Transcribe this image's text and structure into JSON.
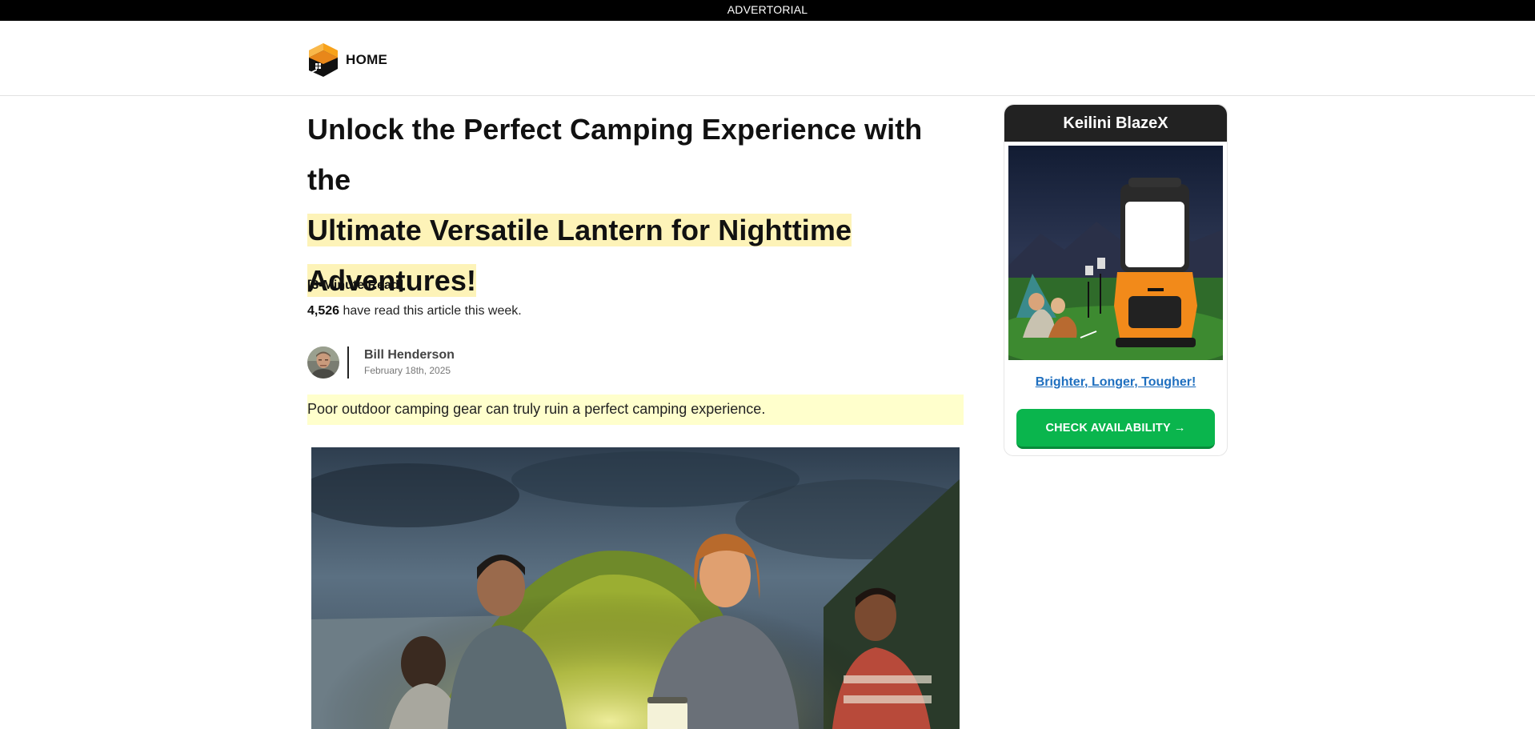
{
  "topbar": {
    "label": "ADVERTORIAL"
  },
  "header": {
    "logo_text": "HOME",
    "logo_icon": "house-cube-icon"
  },
  "article": {
    "headline_plain": "Unlock the Perfect Camping Experience with the",
    "headline_highlight_1": "Ultimate Versatile Lantern for Nighttime",
    "headline_highlight_2": "Adventures!",
    "read_time": "[3-Minute Read]",
    "read_count_number": "4,526",
    "read_count_text": " have read this article this week.",
    "author": {
      "name": "Bill Henderson",
      "date": "February 18th, 2025"
    },
    "lead": "Poor outdoor camping gear can truly ruin a perfect camping experience."
  },
  "sidebar": {
    "product_title": "Keilini BlazeX",
    "tagline": "Brighter, Longer, Tougher!",
    "cta_label": "CHECK AVAILABILITY →"
  },
  "colors": {
    "topbar_bg": "#000000",
    "headline_highlight": "#fdf3b8",
    "lead_bg": "#ffffcc",
    "cta_green": "#0ab54d",
    "link_blue": "#1f6fbf",
    "sidebar_header_bg": "#222222"
  }
}
